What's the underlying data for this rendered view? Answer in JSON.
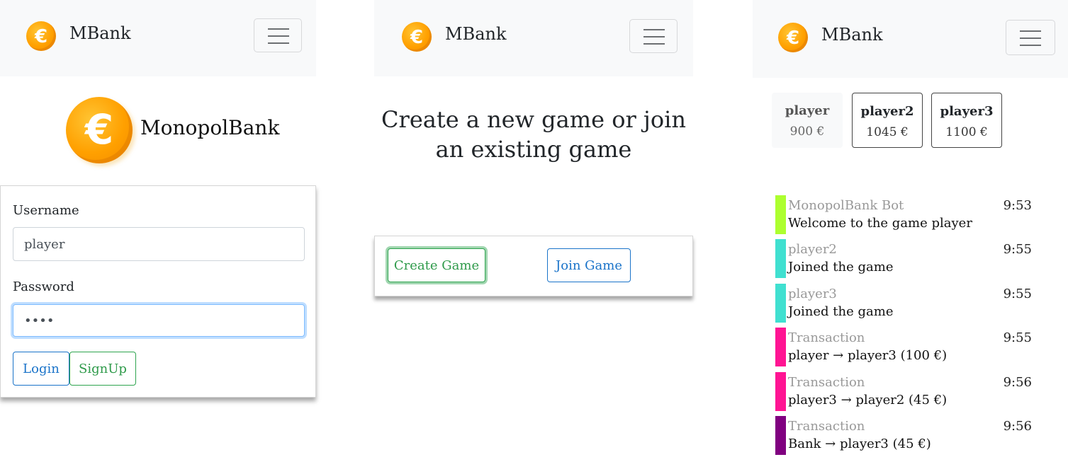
{
  "brand": {
    "name": "MBank",
    "logo_icon": "euro-coin-icon",
    "menu_icon": "hamburger-menu-icon"
  },
  "colors": {
    "navbar_bg": "#f8f9fa",
    "coin": "#ffa000",
    "primary": "#1a73c9",
    "success": "#2e9a4a"
  },
  "login": {
    "logo_title": "MonopolBank",
    "username_label": "Username",
    "username_value": "player",
    "password_label": "Password",
    "password_value": "••••",
    "login_button": "Login",
    "signup_button": "SignUp"
  },
  "lobby": {
    "headline_line1": "Create a new game or join",
    "headline_line2": "an existing game",
    "create_button": "Create Game",
    "join_button": "Join Game"
  },
  "game": {
    "players": [
      {
        "name": "player",
        "balance": "900 €"
      },
      {
        "name": "player2",
        "balance": "1045 €"
      },
      {
        "name": "player3",
        "balance": "1100 €"
      }
    ],
    "messages": [
      {
        "sender": "MonopolBank Bot",
        "text": "Welcome to the game player",
        "time": "9:53",
        "color": "#adff2f"
      },
      {
        "sender": "player2",
        "text": "Joined the game",
        "time": "9:55",
        "color": "#40e0d0"
      },
      {
        "sender": "player3",
        "text": "Joined the game",
        "time": "9:55",
        "color": "#40e0d0"
      },
      {
        "sender": "Transaction",
        "text": "player → player3 (100 €)",
        "time": "9:55",
        "color": "#ff1493"
      },
      {
        "sender": "Transaction",
        "text": "player3 → player2 (45 €)",
        "time": "9:56",
        "color": "#ff1493"
      },
      {
        "sender": "Transaction",
        "text": "Bank → player3 (45 €)",
        "time": "9:56",
        "color": "#800080"
      }
    ]
  }
}
